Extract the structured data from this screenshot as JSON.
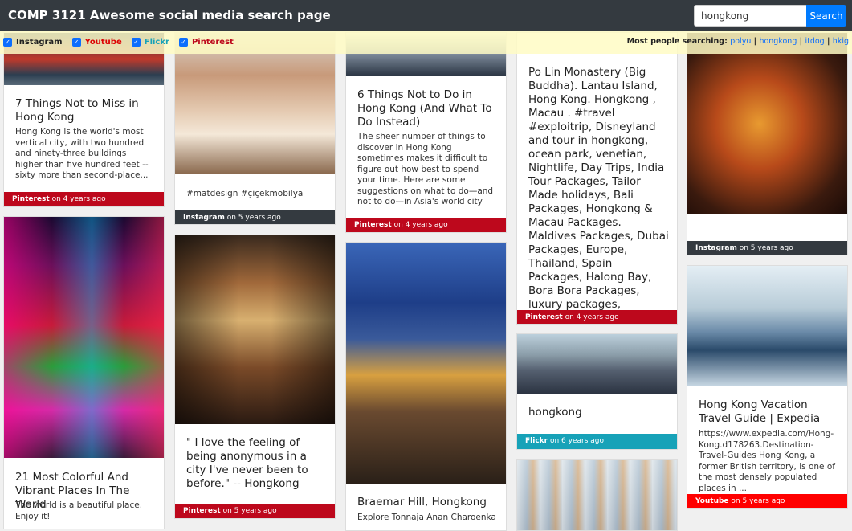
{
  "brand": "COMP 3121 Awesome social media search page",
  "search": {
    "value": "hongkong",
    "button": "Search"
  },
  "filters": [
    {
      "label": "Instagram",
      "color": "#222222"
    },
    {
      "label": "Youtube",
      "color": "#dd0000"
    },
    {
      "label": "Flickr",
      "color": "#17a2b8"
    },
    {
      "label": "Pinterest",
      "color": "#bd081c"
    }
  ],
  "trending": {
    "label": "Most people searching:",
    "items": [
      "polyu",
      "hongkong",
      "itdog",
      "hkig"
    ]
  },
  "cards": [
    {
      "title": "7 Things Not to Miss in Hong Kong",
      "desc": "Hong Kong is the world's most vertical city, with two hundred and ninety-three buildings higher than five hundred feet -- sixty more than second-place...",
      "source": "Pinterest",
      "time": "on 4 years ago"
    },
    {
      "title": "21 Most Colorful And Vibrant Places In The World",
      "desc": "The world is a beautiful place. Enjoy it!",
      "source": "",
      "time": ""
    },
    {
      "title": "",
      "desc": "#matdesign #çiçekmobilya",
      "source": "Instagram",
      "time": "on 5 years ago"
    },
    {
      "title": "\" I love the feeling of being anonymous in a city I've never been to before.\" -- Hongkong",
      "desc": "",
      "source": "Pinterest",
      "time": "on 5 years ago"
    },
    {
      "title": "6 Things Not to Do in Hong Kong (And What To Do Instead)",
      "desc": "The sheer number of things to discover in Hong Kong sometimes makes it difficult to figure out how best to spend your time. Here are some suggestions on what to do—and not to do—in Asia's world city",
      "source": "Pinterest",
      "time": "on 4 years ago"
    },
    {
      "title": "Braemar Hill, Hongkong",
      "desc": "Explore Tonnaja Anan Charoenka",
      "source": "",
      "time": ""
    },
    {
      "title": "Po Lin Monastery (Big Buddha). Lantau Island, Hong Kong. Hongkong , Macau . #travel #exploitrip, Disneyland and tour in hongkong, ocean park, venetian, Nightlife, Day Trips, India Tour Packages, Tailor Made holidays, Bali Packages, Hongkong & Macau Packages. Maldives Packages, Dubai Packages, Europe, Thailand, Spain Packages, Halong Bay, Bora Bora Packages, luxury packages, Mauritius Packages, Singapore Packages, www.exploitrip.com",
      "desc": "",
      "source": "Pinterest",
      "time": "on 4 years ago"
    },
    {
      "title": "hongkong",
      "desc": "",
      "source": "Flickr",
      "time": "on 6 years ago"
    },
    {
      "title": "",
      "desc": "",
      "source": "Instagram",
      "time": "on 5 years ago"
    },
    {
      "title": "Hong Kong Vacation Travel Guide | Expedia",
      "desc": "https://www.expedia.com/Hong-Kong.d178263.Destination-Travel-Guides Hong Kong, a former British territory, is one of the most densely populated places in ...",
      "source": "Youtube",
      "time": "on 5 years ago"
    }
  ]
}
